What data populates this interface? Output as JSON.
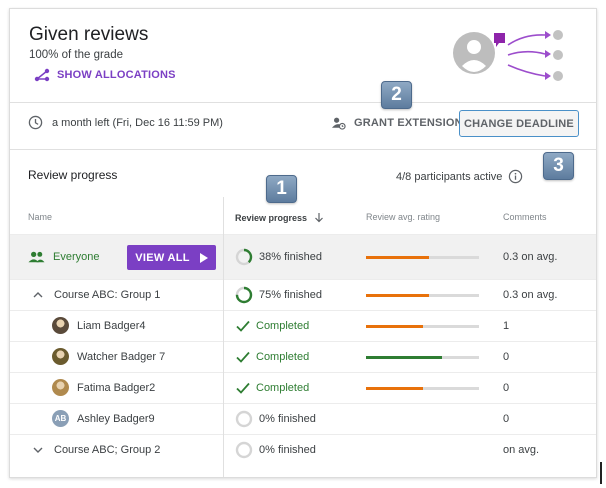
{
  "header": {
    "title": "Given reviews",
    "subtitle": "100% of the grade",
    "show_allocations_label": "SHOW ALLOCATIONS"
  },
  "deadline": {
    "text": "a month left (Fri, Dec 16 11:59 PM)",
    "grant_extension_label": "GRANT EXTENSION",
    "change_deadline_label": "CHANGE DEADLINE"
  },
  "badges": [
    "1",
    "2",
    "3"
  ],
  "review_progress": {
    "title": "Review progress",
    "participants_active": "4/8 participants active",
    "columns": {
      "name": "Name",
      "progress": "Review progress",
      "rating": "Review avg. rating",
      "comments": "Comments"
    },
    "view_all_label": "VIEW ALL",
    "rows": [
      {
        "name": "Everyone",
        "progress": "38% finished",
        "progress_fraction": 0.38,
        "status": "progress",
        "rating_fraction": 0.56,
        "rating_color": "#e8710a",
        "comments": "0.3 on avg."
      },
      {
        "name": "Course ABC: Group 1",
        "progress": "75% finished",
        "progress_fraction": 0.75,
        "status": "progress",
        "rating_fraction": 0.56,
        "rating_color": "#e8710a",
        "comments": "0.3 on avg."
      },
      {
        "name": "Liam Badger4",
        "progress": "Completed",
        "progress_fraction": 1.0,
        "status": "completed",
        "rating_fraction": 0.5,
        "rating_color": "#e8710a",
        "comments": "1"
      },
      {
        "name": "Watcher Badger 7",
        "progress": "Completed",
        "progress_fraction": 1.0,
        "status": "completed",
        "rating_fraction": 0.67,
        "rating_color": "#2e7d32",
        "comments": "0"
      },
      {
        "name": "Fatima Badger2",
        "progress": "Completed",
        "progress_fraction": 1.0,
        "status": "completed",
        "rating_fraction": 0.5,
        "rating_color": "#e8710a",
        "comments": "0"
      },
      {
        "name": "Ashley Badger9",
        "avatar_initials": "AB",
        "progress": "0% finished",
        "progress_fraction": 0.0,
        "status": "progress",
        "rating_fraction": 0,
        "rating_color": "#e8710a",
        "comments": "0"
      },
      {
        "name": "Course ABC; Group 2",
        "progress": "0% finished",
        "progress_fraction": 0.0,
        "status": "progress",
        "rating_fraction": 0,
        "rating_color": "#e8710a",
        "comments": "on avg."
      }
    ]
  },
  "colors": {
    "accent_purple": "#7b3fc4",
    "success_green": "#2e7d32",
    "rating_orange": "#e8710a",
    "focus_blue": "#4a90c8"
  }
}
